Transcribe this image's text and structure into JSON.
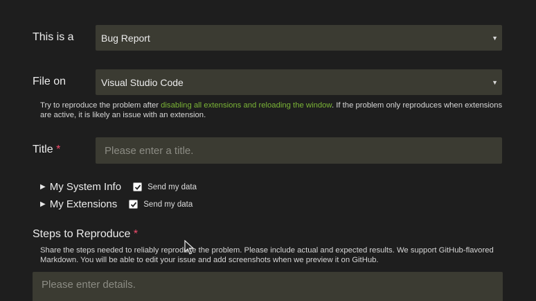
{
  "form": {
    "issue_type": {
      "label": "This is a",
      "value": "Bug Report"
    },
    "file_on": {
      "label": "File on",
      "value": "Visual Studio Code",
      "help_before": "Try to reproduce the problem after ",
      "help_link": "disabling all extensions and reloading the window",
      "help_after": ". If the problem only reproduces when extensions are active, it is likely an issue with an extension."
    },
    "title": {
      "label": "Title",
      "required_mark": "*",
      "placeholder": "Please enter a title."
    },
    "system_info": {
      "label": "My System Info",
      "checkbox_label": "Send my data"
    },
    "extensions": {
      "label": "My Extensions",
      "checkbox_label": "Send my data"
    },
    "steps": {
      "label": "Steps to Reproduce",
      "required_mark": "*",
      "help": "Share the steps needed to reliably reproduce the problem. Please include actual and expected results. We support GitHub-flavored Markdown. You will be able to edit your issue and add screenshots when we preview it on GitHub.",
      "placeholder": "Please enter details."
    }
  },
  "colors": {
    "background": "#1e1e1e",
    "field": "#3b3b32",
    "link": "#7bb536",
    "required": "#f14c6c"
  }
}
